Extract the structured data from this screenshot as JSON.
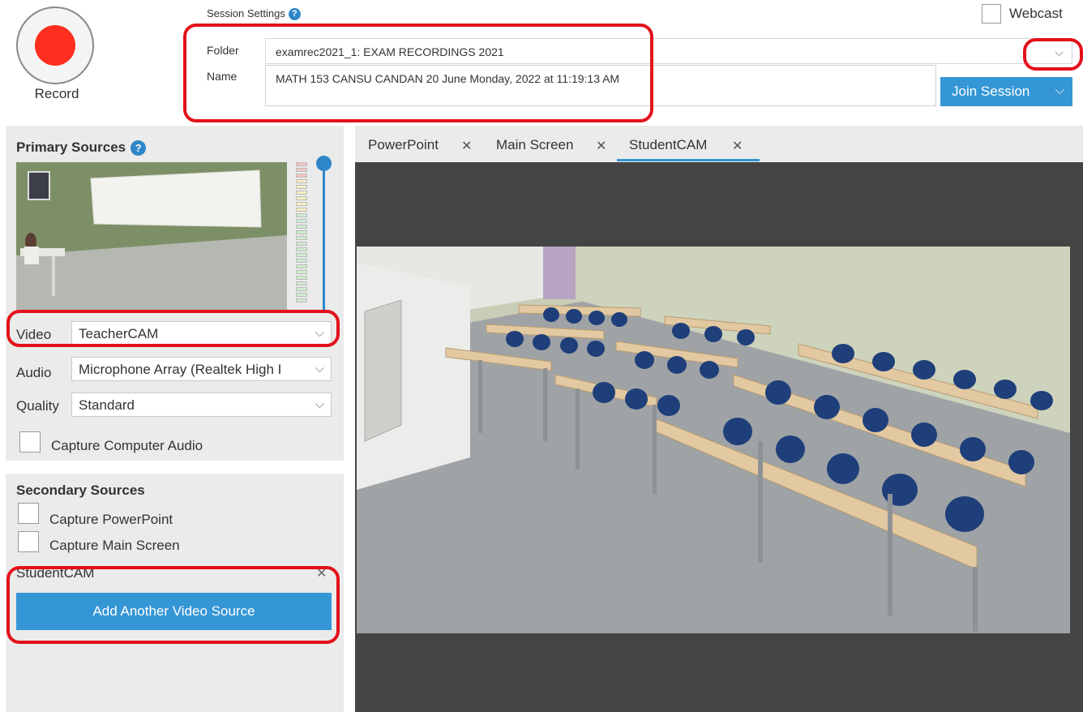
{
  "header": {
    "record_label": "Record",
    "session_settings_label": "Session Settings",
    "folder_label": "Folder",
    "folder_value": "examrec2021_1: EXAM RECORDINGS 2021",
    "name_label": "Name",
    "name_value": "MATH 153 CANSU CANDAN 20 June Monday,  2022 at 11:19:13 AM",
    "join_label": "Join Session",
    "webcast_label": "Webcast",
    "webcast_checked": false,
    "record_color": "#ff2e1f"
  },
  "primary": {
    "title": "Primary Sources",
    "video_label": "Video",
    "video_value": "TeacherCAM",
    "audio_label": "Audio",
    "audio_value": "Microphone Array (Realtek High I",
    "quality_label": "Quality",
    "quality_value": "Standard",
    "capture_audio_label": "Capture Computer Audio",
    "capture_audio_checked": false
  },
  "secondary": {
    "title": "Secondary Sources",
    "capture_ppt_label": "Capture PowerPoint",
    "capture_screen_label": "Capture Main Screen",
    "cam_label": "StudentCAM",
    "add_label": "Add Another Video Source"
  },
  "tabs": [
    {
      "label": "PowerPoint",
      "active": false
    },
    {
      "label": "Main Screen",
      "active": false
    },
    {
      "label": "StudentCAM",
      "active": true
    }
  ],
  "icons": {
    "help": "?",
    "chevron": "⌵",
    "close": "✕"
  },
  "colors": {
    "accent": "#3596d6",
    "highlight": "#e3111b"
  }
}
